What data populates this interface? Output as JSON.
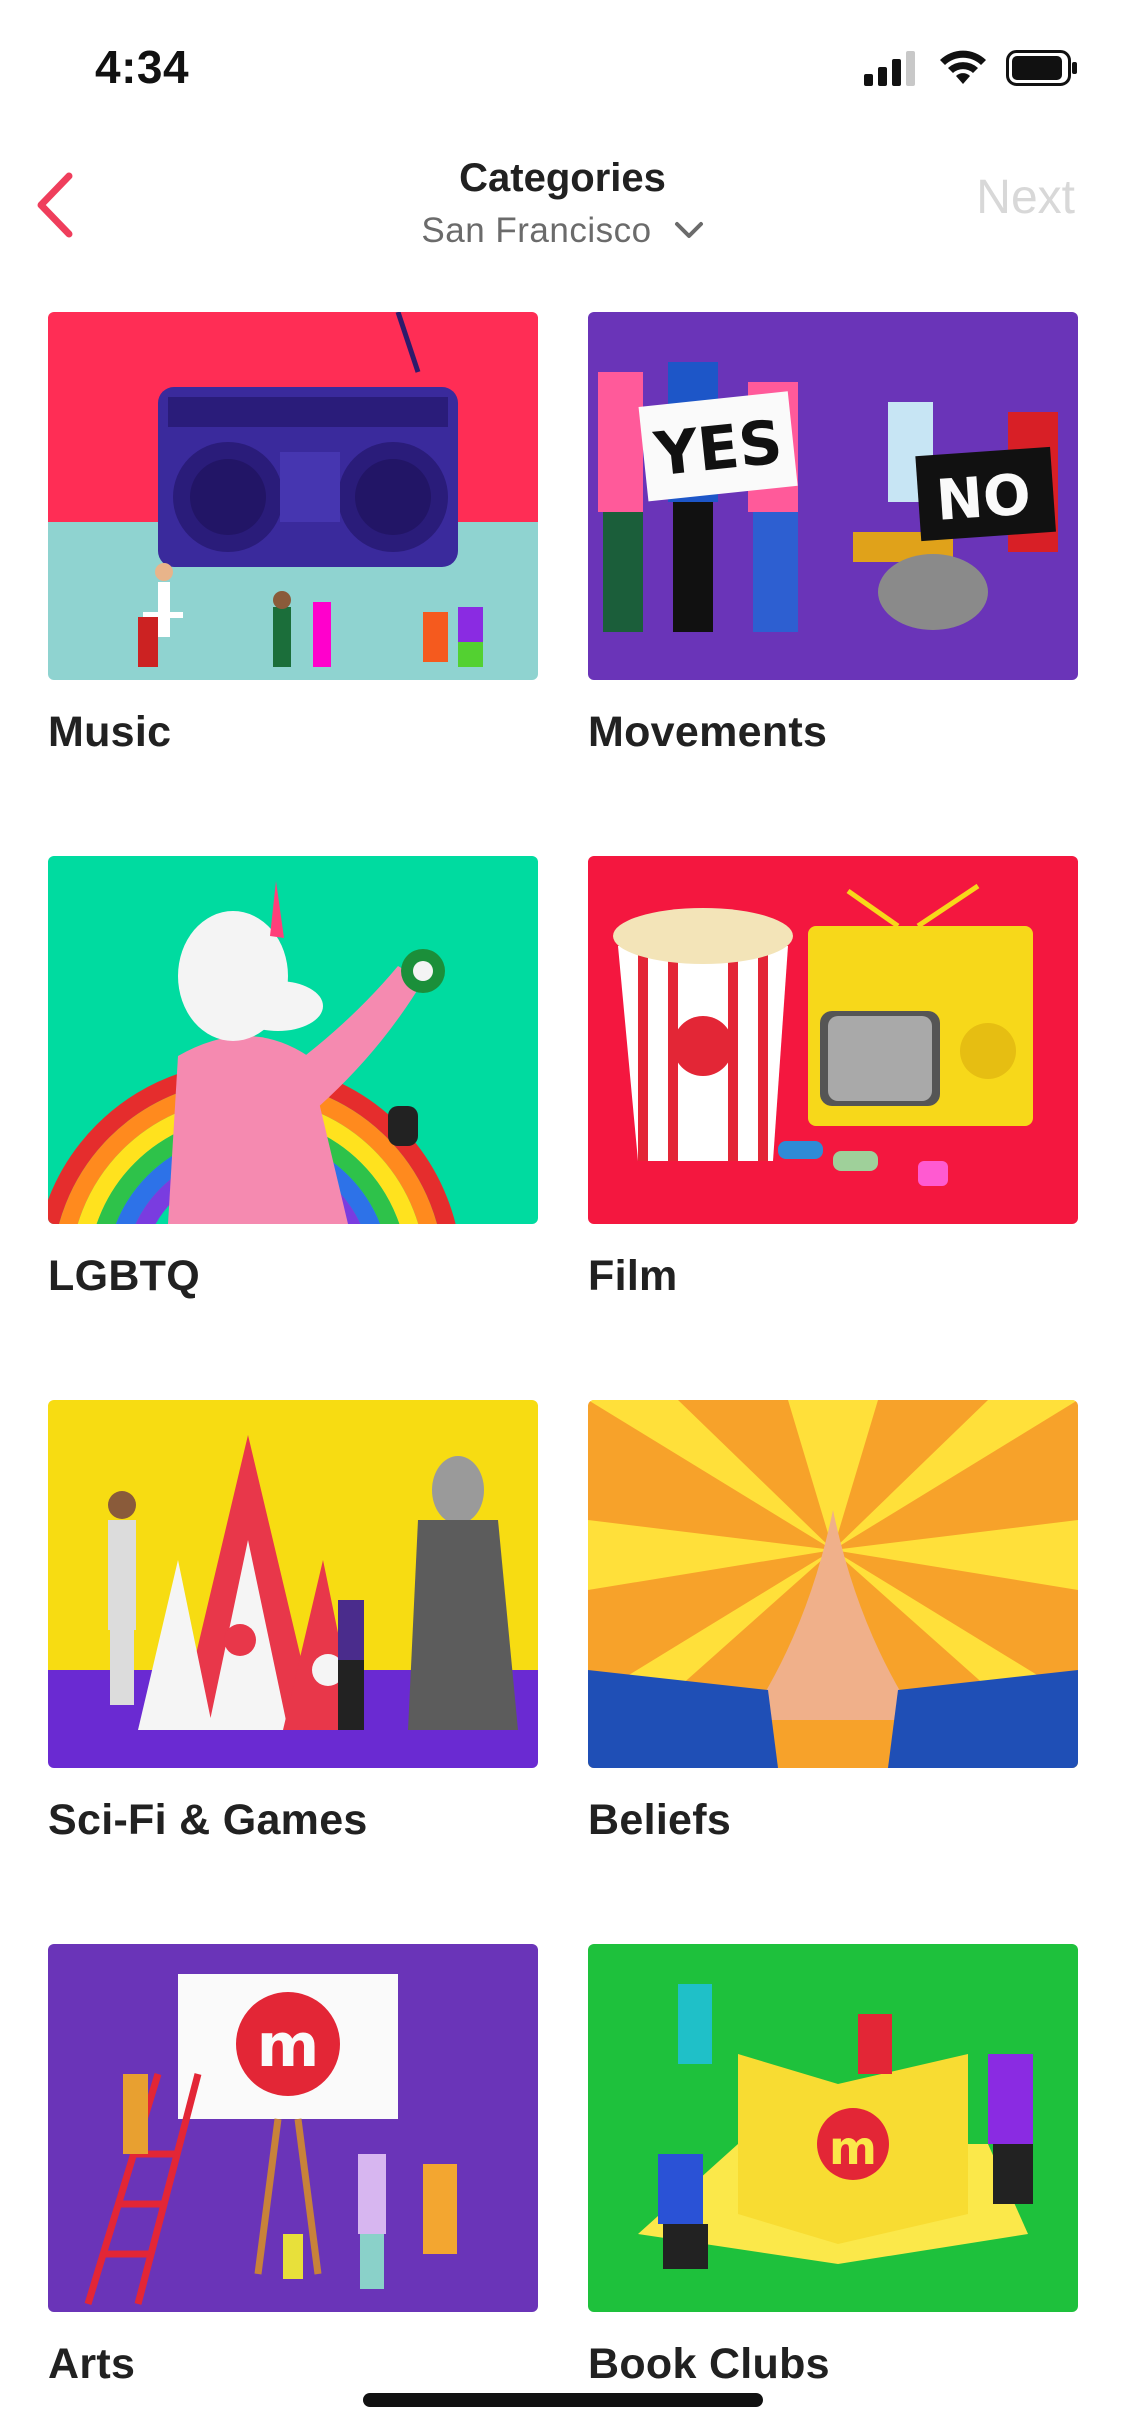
{
  "status": {
    "time": "4:34"
  },
  "nav": {
    "title": "Categories",
    "location": "San Francisco",
    "next_label": "Next"
  },
  "categories": [
    {
      "label": "Music",
      "bg": "#ff2d55"
    },
    {
      "label": "Movements",
      "bg": "#6a34b8"
    },
    {
      "label": "LGBTQ",
      "bg": "#00dba0"
    },
    {
      "label": "Film",
      "bg": "#f4173f"
    },
    {
      "label": "Sci-Fi & Games",
      "bg": "#f7dc12"
    },
    {
      "label": "Beliefs",
      "bg": "#f7a22a"
    },
    {
      "label": "Arts",
      "bg": "#6a34b8"
    },
    {
      "label": "Book Clubs",
      "bg": "#1ec13c"
    }
  ],
  "images": {
    "movements_sign_yes": "YES",
    "movements_sign_no": "NO"
  },
  "colors": {
    "accent": "#ef3e5c",
    "next_disabled": "#d8d8d8"
  }
}
